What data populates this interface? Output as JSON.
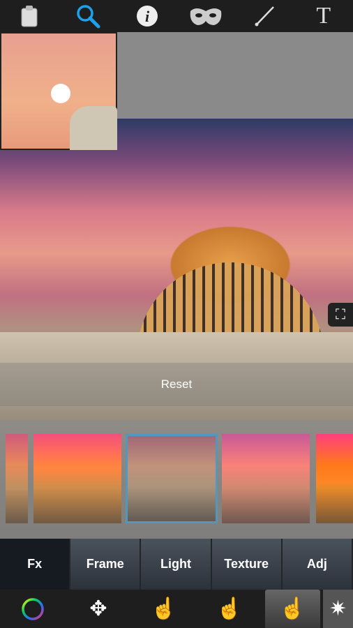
{
  "toolbar": {
    "items": [
      {
        "name": "clipboard-icon",
        "glyph": "📋"
      },
      {
        "name": "search-icon",
        "glyph": "🔍",
        "active": true
      },
      {
        "name": "info-icon",
        "glyph": "ℹ"
      },
      {
        "name": "mask-icon",
        "glyph": "∞"
      },
      {
        "name": "brush-icon",
        "glyph": "╱"
      },
      {
        "name": "text-icon",
        "glyph": "T"
      }
    ],
    "accent": "#1aa3ec"
  },
  "canvas": {
    "reset_label": "Reset",
    "fullscreen_glyph": "⛶"
  },
  "filters": {
    "selected_index": 2,
    "count_visible": 5
  },
  "tabs": [
    {
      "label": "Fx",
      "active": true
    },
    {
      "label": "Frame"
    },
    {
      "label": "Light"
    },
    {
      "label": "Texture"
    },
    {
      "label": "Adj"
    }
  ],
  "bottom": {
    "items": [
      {
        "name": "color-ring-icon",
        "glyph": "◯"
      },
      {
        "name": "hand-move-icon",
        "glyph": "✥"
      },
      {
        "name": "hand-circle-icon",
        "glyph": "☝"
      },
      {
        "name": "hand-color-icon",
        "glyph": "☝"
      },
      {
        "name": "hand-erase-icon",
        "glyph": "☝",
        "active": true
      },
      {
        "name": "magic-wand-icon",
        "glyph": "✷"
      }
    ]
  }
}
